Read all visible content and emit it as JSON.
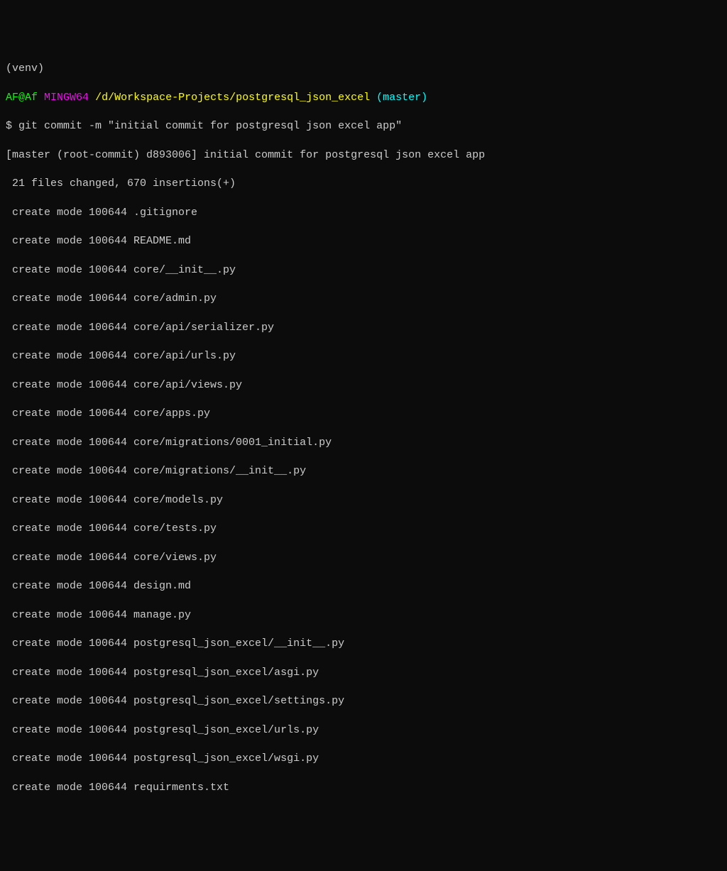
{
  "venv_line": "(venv)",
  "prompt_line": {
    "user_host": "AF@Af",
    "mingw": "MINGW64",
    "path": "/d/Workspace-Projects/postgresql_json_excel",
    "branch": "(master)"
  },
  "command_line": {
    "prompt": "$ ",
    "command": "git commit -m \"initial commit for postgresql json excel app\""
  },
  "commit_result": "[master (root-commit) d893006] initial commit for postgresql json excel app",
  "summary": " 21 files changed, 670 insertions(+)",
  "created_files": [
    " create mode 100644 .gitignore",
    " create mode 100644 README.md",
    " create mode 100644 core/__init__.py",
    " create mode 100644 core/admin.py",
    " create mode 100644 core/api/serializer.py",
    " create mode 100644 core/api/urls.py",
    " create mode 100644 core/api/views.py",
    " create mode 100644 core/apps.py",
    " create mode 100644 core/migrations/0001_initial.py",
    " create mode 100644 core/migrations/__init__.py",
    " create mode 100644 core/models.py",
    " create mode 100644 core/tests.py",
    " create mode 100644 core/views.py",
    " create mode 100644 design.md",
    " create mode 100644 manage.py",
    " create mode 100644 postgresql_json_excel/__init__.py",
    " create mode 100644 postgresql_json_excel/asgi.py",
    " create mode 100644 postgresql_json_excel/settings.py",
    " create mode 100644 postgresql_json_excel/urls.py",
    " create mode 100644 postgresql_json_excel/wsgi.py",
    " create mode 100644 requirments.txt"
  ]
}
